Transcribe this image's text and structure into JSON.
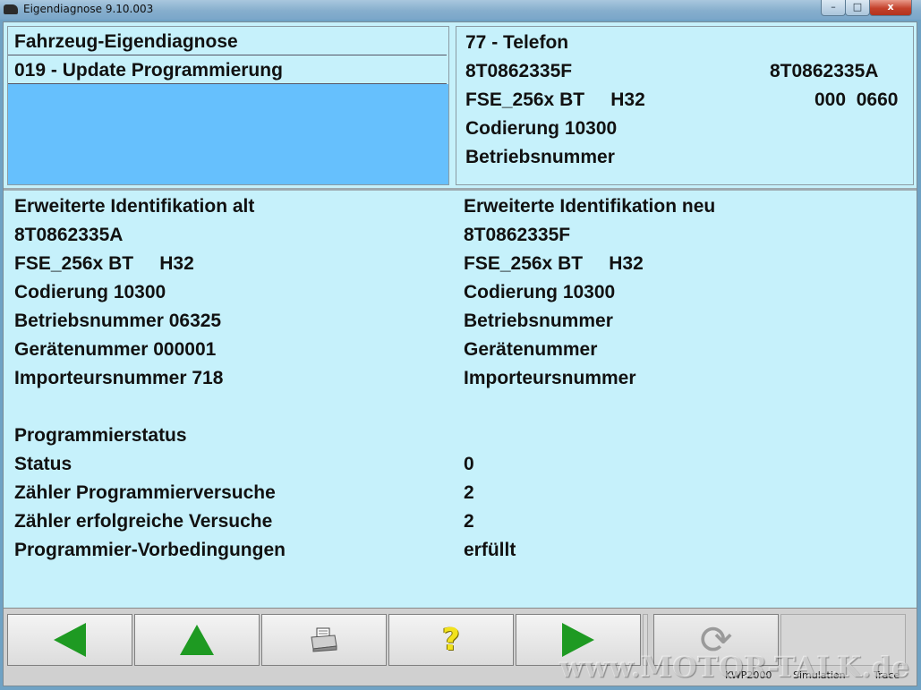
{
  "window": {
    "title": "Eigendiagnose 9.10.003",
    "buttons": {
      "minimize": "–",
      "maximize": "□",
      "close": "x"
    }
  },
  "header_left": {
    "line1": "Fahrzeug-Eigendiagnose",
    "line2": "019 - Update Programmierung"
  },
  "header_right": {
    "title": "77 - Telefon",
    "part_left": "8T0862335F",
    "part_right": "8T0862335A",
    "component": "FSE_256x BT     H32",
    "version": "000  0660",
    "coding": "Codierung 10300",
    "workshop": "Betriebsnummer"
  },
  "ident_old": {
    "title": "Erweiterte Identifikation alt",
    "part": "8T0862335A",
    "component": "FSE_256x BT     H32",
    "coding": "Codierung 10300",
    "workshop": "Betriebsnummer 06325",
    "device": "Gerätenummer 000001",
    "importer": "Importeursnummer 718"
  },
  "ident_new": {
    "title": "Erweiterte Identifikation neu",
    "part": "8T0862335F",
    "component": "FSE_256x BT     H32",
    "coding": "Codierung 10300",
    "workshop": "Betriebsnummer",
    "device": "Gerätenummer",
    "importer": "Importeursnummer"
  },
  "programming": {
    "heading": "Programmierstatus",
    "rows": [
      {
        "label": "Status",
        "value": "0"
      },
      {
        "label": "Zähler Programmierversuche",
        "value": "2"
      },
      {
        "label": "Zähler erfolgreiche Versuche",
        "value": "2"
      },
      {
        "label": "Programmier-Vorbedingungen",
        "value": "erfüllt"
      }
    ]
  },
  "toolbar": {
    "buttons": [
      {
        "icon": "arrow-left-icon"
      },
      {
        "icon": "arrow-up-icon"
      },
      {
        "icon": "printer-icon"
      },
      {
        "icon": "help-icon",
        "glyph": "?"
      },
      {
        "icon": "arrow-right-icon"
      },
      {
        "icon": "refresh-icon",
        "glyph": "⟳"
      }
    ],
    "colors": {
      "arrow": "#1e9a22",
      "help": "#f2e21b"
    }
  },
  "statusbar": {
    "protocol": "KWP2000",
    "simulation": "Simulation",
    "trace": "Trace"
  },
  "watermark": "www.MOTOR-TALK.de"
}
